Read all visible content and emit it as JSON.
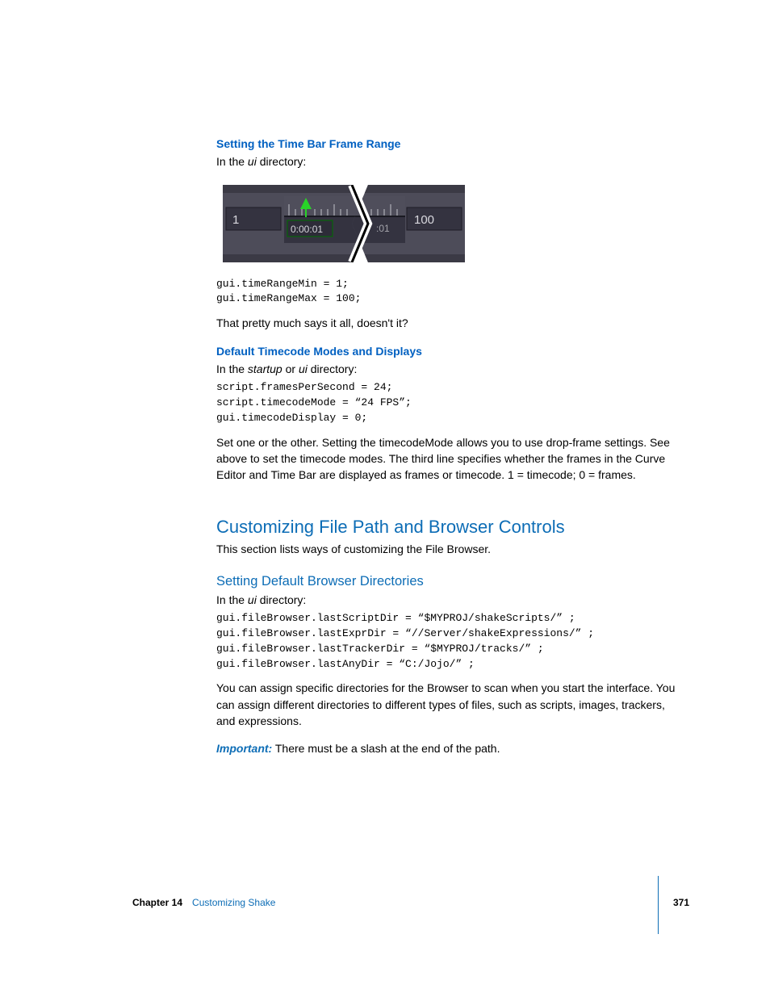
{
  "section1": {
    "heading": "Setting the Time Bar Frame Range",
    "intro_pre": "In the ",
    "intro_italic": "ui",
    "intro_post": " directory:",
    "timebar": {
      "min": "1",
      "timecode": "0:00:01",
      "right_tick": ":01",
      "max": "100"
    },
    "code": "gui.timeRangeMin = 1;\ngui.timeRangeMax = 100;",
    "closing": "That pretty much says it all, doesn't it?"
  },
  "section2": {
    "heading": "Default Timecode Modes and Displays",
    "intro_pre": "In the ",
    "intro_italic1": "startup",
    "intro_mid": " or ",
    "intro_italic2": "ui",
    "intro_post": " directory:",
    "code": "script.framesPerSecond = 24;\nscript.timecodeMode = “24 FPS”;\ngui.timecodeDisplay = 0;",
    "body": "Set one or the other. Setting the timecodeMode allows you to use drop-frame settings. See above to set the timecode modes. The third line specifies whether the frames in the Curve Editor and Time Bar are displayed as frames or timecode. 1 = timecode; 0 = frames."
  },
  "section3": {
    "heading": "Customizing File Path and Browser Controls",
    "intro": "This section lists ways of customizing the File Browser."
  },
  "section4": {
    "heading": "Setting Default Browser Directories",
    "intro_pre": "In the ",
    "intro_italic": "ui",
    "intro_post": " directory:",
    "code": "gui.fileBrowser.lastScriptDir = “$MYPROJ/shakeScripts/” ;\ngui.fileBrowser.lastExprDir = “//Server/shakeExpressions/” ;\ngui.fileBrowser.lastTrackerDir = “$MYPROJ/tracks/” ;\ngui.fileBrowser.lastAnyDir = “C:/Jojo/” ;",
    "body": "You can assign specific directories for the Browser to scan when you start the interface. You can assign different directories to different types of files, such as scripts, images, trackers, and expressions.",
    "important_label": "Important:",
    "important_body": "  There must be a slash at the end of the path."
  },
  "footer": {
    "chapter_label": "Chapter 14",
    "chapter_title": "Customizing Shake",
    "page": "371"
  }
}
